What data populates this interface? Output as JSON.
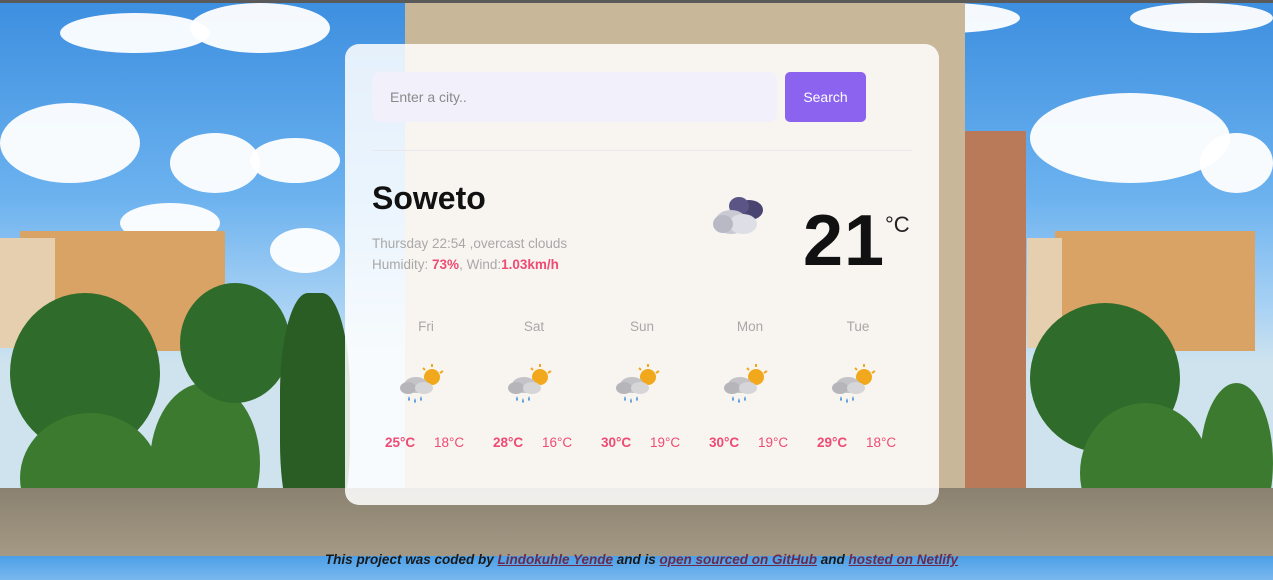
{
  "search": {
    "placeholder": "Enter a city..",
    "button_label": "Search"
  },
  "current": {
    "city": "Soweto",
    "day_time": "Thursday 22:54",
    "description": ",overcast clouds",
    "humidity_label": "Humidity:",
    "humidity_value": "73%",
    "wind_label": "Wind:",
    "wind_value": "1.03km/h",
    "temperature": "21",
    "unit": "°C",
    "icon": "overcast-clouds-icon"
  },
  "forecast": [
    {
      "day": "Fri",
      "max": "25°C",
      "min": "18°C",
      "icon": "sun-cloud-rain-icon"
    },
    {
      "day": "Sat",
      "max": "28°C",
      "min": "16°C",
      "icon": "sun-cloud-rain-icon"
    },
    {
      "day": "Sun",
      "max": "30°C",
      "min": "19°C",
      "icon": "sun-cloud-rain-icon"
    },
    {
      "day": "Mon",
      "max": "30°C",
      "min": "19°C",
      "icon": "sun-cloud-rain-icon"
    },
    {
      "day": "Tue",
      "max": "29°C",
      "min": "18°C",
      "icon": "sun-cloud-rain-icon"
    }
  ],
  "footer": {
    "text1": "This project was coded by ",
    "author_link": "Lindokuhle Yende",
    "text2": " and is ",
    "github_link": "open sourced on GitHub",
    "text3": " and ",
    "netlify_link": "hosted on Netlify"
  },
  "colors": {
    "accent": "#8b63ee",
    "highlight": "#ee4a73"
  }
}
